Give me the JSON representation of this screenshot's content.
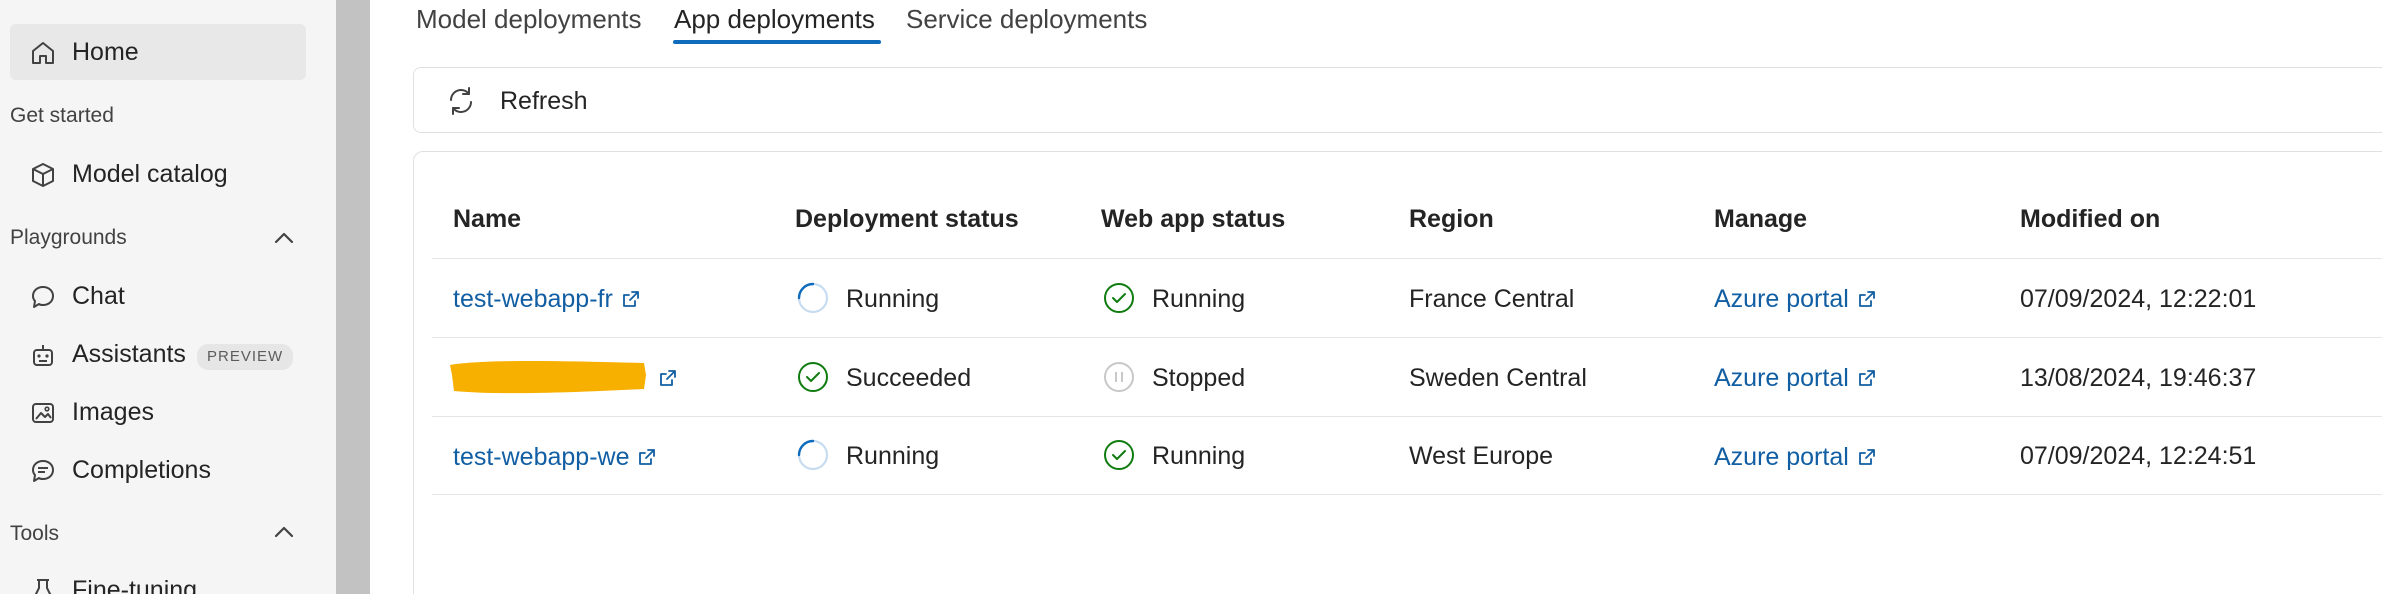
{
  "sidebar": {
    "home": {
      "label": "Home"
    },
    "get_started": {
      "label": "Get started"
    },
    "model_catalog": {
      "label": "Model catalog"
    },
    "playgrounds": {
      "label": "Playgrounds"
    },
    "chat": {
      "label": "Chat"
    },
    "assistants": {
      "label": "Assistants",
      "badge": "PREVIEW"
    },
    "images": {
      "label": "Images"
    },
    "completions": {
      "label": "Completions"
    },
    "tools": {
      "label": "Tools"
    },
    "fine_tuning": {
      "label": "Fine-tuning"
    }
  },
  "tabs": [
    {
      "label": "Model deployments"
    },
    {
      "label": "App deployments"
    },
    {
      "label": "Service deployments"
    }
  ],
  "toolbar": {
    "refresh_label": "Refresh"
  },
  "table": {
    "columns": [
      "Name",
      "Deployment status",
      "Web app status",
      "Region",
      "Manage",
      "Modified on"
    ],
    "rows": [
      {
        "name": "test-webapp-fr",
        "deployment_status": "Running",
        "webapp_status": "Running",
        "region": "France Central",
        "manage": "Azure portal",
        "modified": "07/09/2024, 12:22:01"
      },
      {
        "name": "",
        "deployment_status": "Succeeded",
        "webapp_status": "Stopped",
        "region": "Sweden Central",
        "manage": "Azure portal",
        "modified": "13/08/2024, 19:46:37"
      },
      {
        "name": "test-webapp-we",
        "deployment_status": "Running",
        "webapp_status": "Running",
        "region": "West Europe",
        "manage": "Azure portal",
        "modified": "07/09/2024, 12:24:51"
      }
    ]
  },
  "colors": {
    "accent": "#0f6cbd",
    "link": "#115ea3",
    "success": "#107c10",
    "redaction": "#f7b000"
  }
}
